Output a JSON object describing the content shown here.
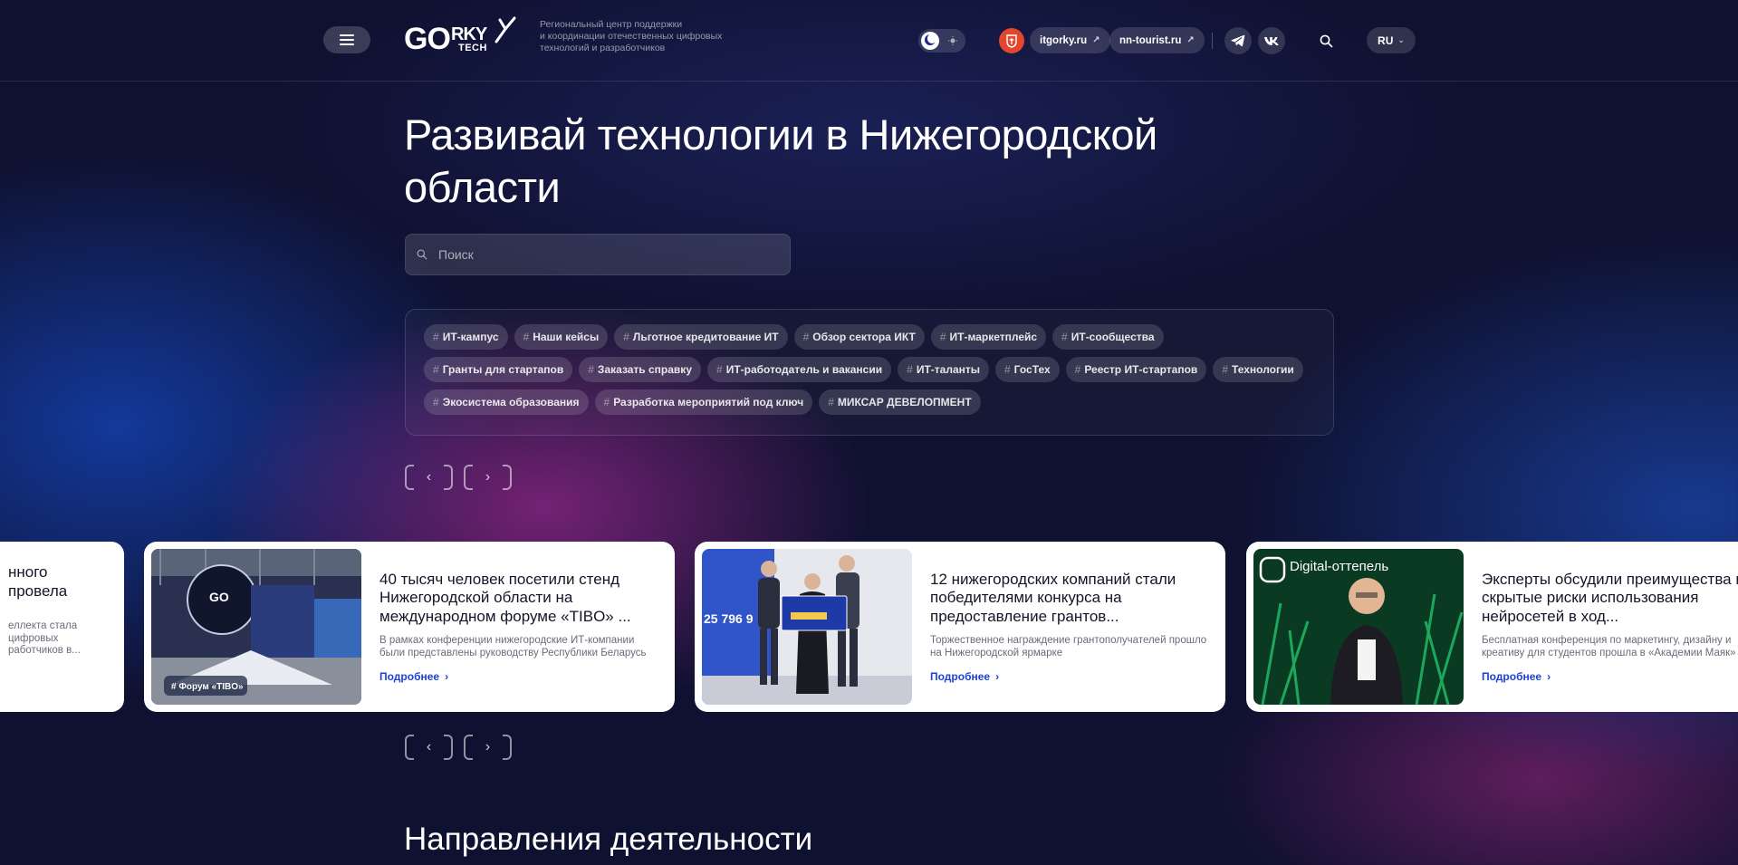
{
  "header": {
    "logo_text": "GORKY TECH",
    "tagline": [
      "Региональный центр поддержки",
      "и координации отечественных цифровых",
      "технологий и разработчиков"
    ],
    "links": [
      {
        "label": "itgorky.ru",
        "icon": "external-arrow-icon"
      },
      {
        "label": "nn-tourist.ru",
        "icon": "external-arrow-icon"
      }
    ],
    "social": [
      "telegram-icon",
      "vk-icon"
    ],
    "language": "RU"
  },
  "hero": {
    "title": "Развивай технологии в Нижегородской области",
    "search_placeholder": "Поиск"
  },
  "tags": [
    "ИТ-кампус",
    "Наши кейсы",
    "Льготное кредитование ИТ",
    "Обзор сектора ИКТ",
    "ИТ-маркетплейс",
    "ИТ-сообщества",
    "Гранты для стартапов",
    "Заказать справку",
    "ИТ-работодатель и вакансии",
    "ИТ-таланты",
    "ГосТех",
    "Реестр ИТ-стартапов",
    "Технологии",
    "Экосистема образования",
    "Разработка мероприятий под ключ",
    "МИКСАР ДЕВЕЛОПМЕНТ"
  ],
  "tag_symbol": "#",
  "news": {
    "partial_card": {
      "title_lines": [
        "нного",
        "провела"
      ],
      "desc_lines": [
        "еллекта стала",
        "цифровых",
        "работчиков в..."
      ]
    },
    "cards": [
      {
        "title": "40 тысяч человек посетили стенд Нижегородской области на международном форуме «TIBO» ...",
        "desc": "В рамках конференции нижегородские ИТ-компании были представлены руководству Республики Беларусь",
        "more": "Подробнее",
        "image_caption": "# Форум «TIBO»"
      },
      {
        "title": "12 нижегородских компаний стали победителями конкурса на предоставление грантов...",
        "desc": "Торжественное награждение грантополучателей прошло на Нижегородской ярмарке",
        "more": "Подробнее",
        "image_text": "25 796 9"
      },
      {
        "title": "Эксперты обсудили преимущества и скрытые риски использования нейросетей в ход...",
        "desc": "Бесплатная конференция по маркетингу, дизайну и креативу для студентов прошла в «Академии Маяк»",
        "more": "Подробнее",
        "image_text": "Digital-оттепель"
      }
    ]
  },
  "section_title": "Направления деятельности",
  "colors": {
    "background": "#0f1130",
    "link_blue": "#1e3fd9",
    "region_badge": "#e3452d"
  }
}
